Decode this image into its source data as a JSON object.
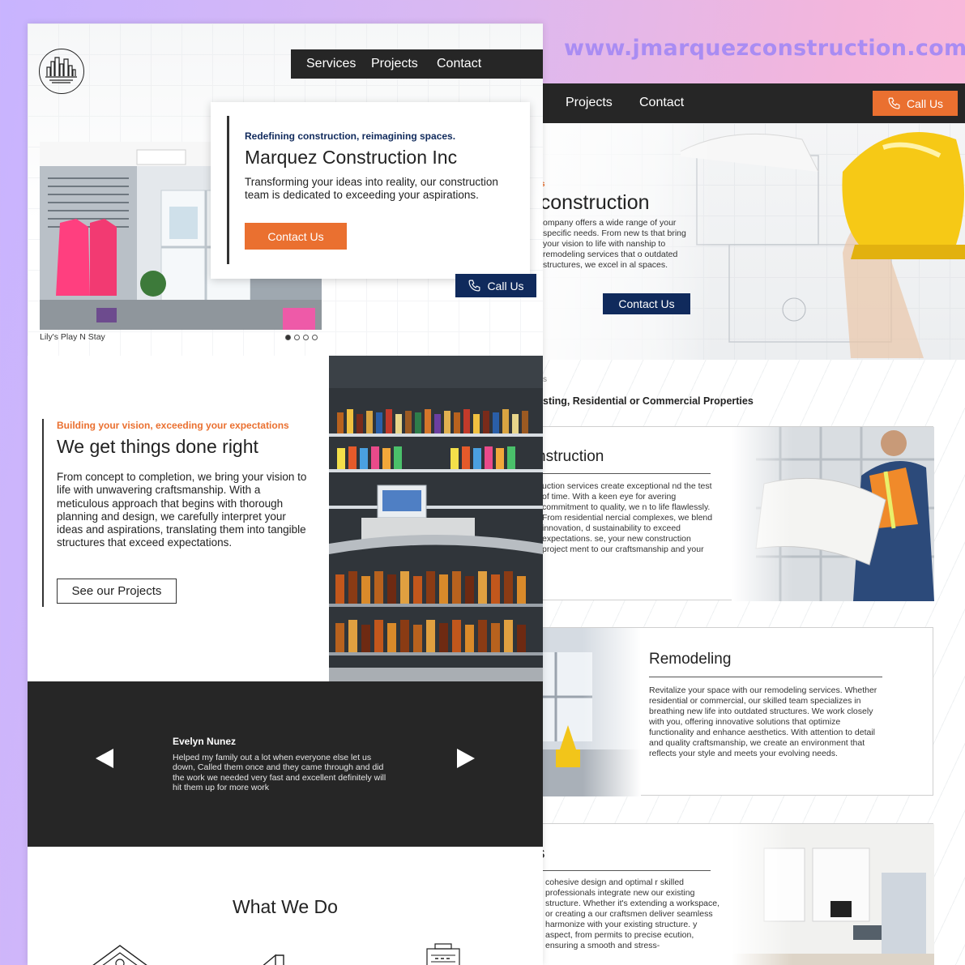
{
  "url": "www.jmarquezconstruction.com",
  "colors": {
    "accent": "#ea7030",
    "navy": "#102a5c",
    "dark": "#262626"
  },
  "back_page": {
    "nav": {
      "projects": "Projects",
      "contact": "Contact",
      "call": "Call Us"
    },
    "hero": {
      "eyebrow": "s",
      "title": "ng construction",
      "body": "ompany offers a wide range of your specific needs. From new ts that bring your vision to life with nanship to remodeling services that o outdated structures, we excel in al spaces.",
      "button": "Contact Us"
    },
    "services_eyebrow": "s",
    "services_heading": "sting, Residential or Commercial Properties",
    "cards": [
      {
        "title": "nstruction",
        "body": "uction services create exceptional nd the test of time. With a keen eye for avering commitment to quality, we n to life flawlessly. From residential nercial complexes, we blend innovation, d sustainability to exceed expectations. se, your new construction project ment to our craftsmanship and your"
      },
      {
        "title": "Remodeling",
        "body": "Revitalize your space with our remodeling services. Whether residential or commercial, our skilled team specializes in breathing new life into outdated structures. We work closely with you, offering innovative solutions that optimize functionality and enhance aesthetics. With attention to detail and quality craftsmanship, we create an environment that reflects your style and meets your evolving needs."
      },
      {
        "title": "s",
        "body": "cohesive design and optimal r skilled professionals integrate new our existing structure. Whether it's extending a workspace, or creating a our craftsmen deliver seamless harmonize with your existing structure. y aspect, from permits to precise ecution, ensuring a smooth and stress-"
      }
    ]
  },
  "front_page": {
    "nav": {
      "services": "Services",
      "projects": "Projects",
      "contact": "Contact"
    },
    "hero": {
      "eyebrow": "Redefining construction, reimagining spaces.",
      "title": "Marquez Construction Inc",
      "body": "Transforming your ideas into reality, our construction team is dedicated to exceeding your aspirations.",
      "button": "Contact Us",
      "call": "Call Us",
      "caption": "Lily's Play N Stay"
    },
    "about": {
      "eyebrow": "Building your vision, exceeding your expectations",
      "title": "We get things done right",
      "body": "From concept to completion, we bring your vision to life with unwavering craftsmanship. With a meticulous approach that begins with thorough planning and design, we carefully interpret your ideas and aspirations, translating them into tangible structures that exceed expectations.",
      "button": "See our Projects"
    },
    "testimonial": {
      "name": "Evelyn Nunez",
      "quote": "Helped my family out a lot when everyone else let us down, Called them once and they came through and did the work we needed very fast and excellent definitely will hit them up for more work"
    },
    "what_we_do": "What We Do"
  }
}
